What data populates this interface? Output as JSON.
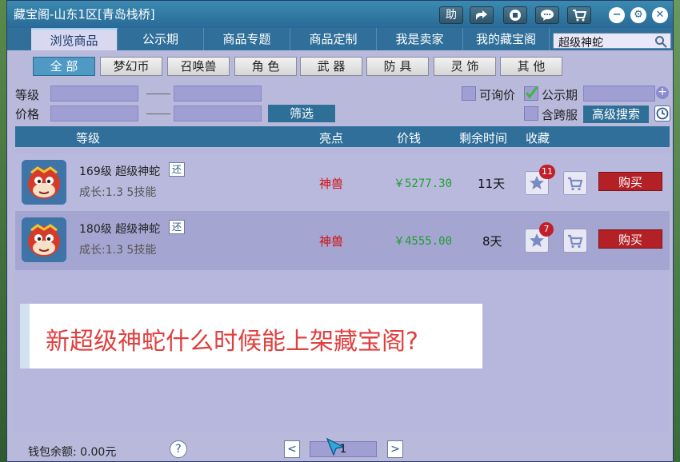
{
  "window": {
    "title": "藏宝阁-山东1区[青岛栈桥]"
  },
  "titlebar_buttons": [
    {
      "label": "助",
      "icon": "help-text-icon"
    },
    {
      "label": "",
      "icon": "share-icon"
    },
    {
      "label": "",
      "icon": "record-icon"
    },
    {
      "label": "",
      "icon": "chat-icon"
    },
    {
      "label": "",
      "icon": "cart-icon"
    }
  ],
  "tabs": [
    "浏览商品",
    "公示期",
    "商品专题",
    "商品定制",
    "我是卖家",
    "我的藏宝阁"
  ],
  "search": {
    "value": "超级神蛇"
  },
  "categories": [
    "全 部",
    "梦幻币",
    "召唤兽",
    "角 色",
    "武 器",
    "防 具",
    "灵 饰",
    "其 他"
  ],
  "filters": {
    "level_label": "等级",
    "price_label": "价格",
    "filter_button": "筛选",
    "inquiry_label": "可询价",
    "public_label": "公示期",
    "cross_server_label": "含跨服",
    "advanced_search": "高级搜索"
  },
  "list_header": {
    "level": "等级",
    "highlight": "亮点",
    "price": "价钱",
    "time_left": "剩余时间",
    "favorite": "收藏"
  },
  "items": [
    {
      "name": "169级  超级神蛇",
      "tag": "还",
      "sub": "成长:1.3  5技能",
      "highlight": "神兽",
      "price": "￥5277.30",
      "time_left": "11天",
      "fav_count": "11",
      "buy": "购买"
    },
    {
      "name": "180级  超级神蛇",
      "tag": "还",
      "sub": "成长:1.3  5技能",
      "highlight": "神兽",
      "price": "￥4555.00",
      "time_left": "8天",
      "fav_count": "7",
      "buy": "购买"
    }
  ],
  "banner": {
    "text": "新超级神蛇什么时候能上架藏宝阁?"
  },
  "footer": {
    "wallet": "钱包余额: 0.00元",
    "help": "?",
    "page": "1",
    "prev": "<",
    "next": ">"
  }
}
